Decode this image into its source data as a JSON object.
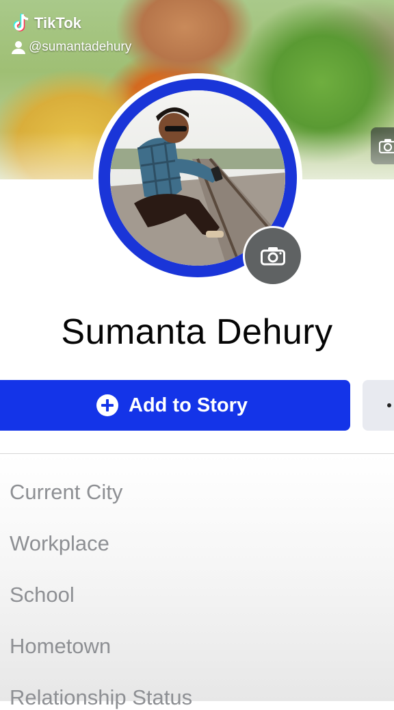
{
  "watermark": {
    "brand": "TikTok",
    "username": "@sumantadehury"
  },
  "profile": {
    "name": "Sumanta Dehury"
  },
  "actions": {
    "add_story_label": "Add to Story",
    "more_label": ""
  },
  "details": [
    "Current City",
    "Workplace",
    "School",
    "Hometown",
    "Relationship Status"
  ],
  "colors": {
    "primary_button": "#1434e8",
    "avatar_ring": "#1a35d8",
    "detail_text": "#8d8f93",
    "name_text": "#050505"
  },
  "icons": {
    "brand": "tiktok-logo-icon",
    "user": "user-icon",
    "camera": "camera-icon",
    "add": "plus-circle-icon"
  }
}
